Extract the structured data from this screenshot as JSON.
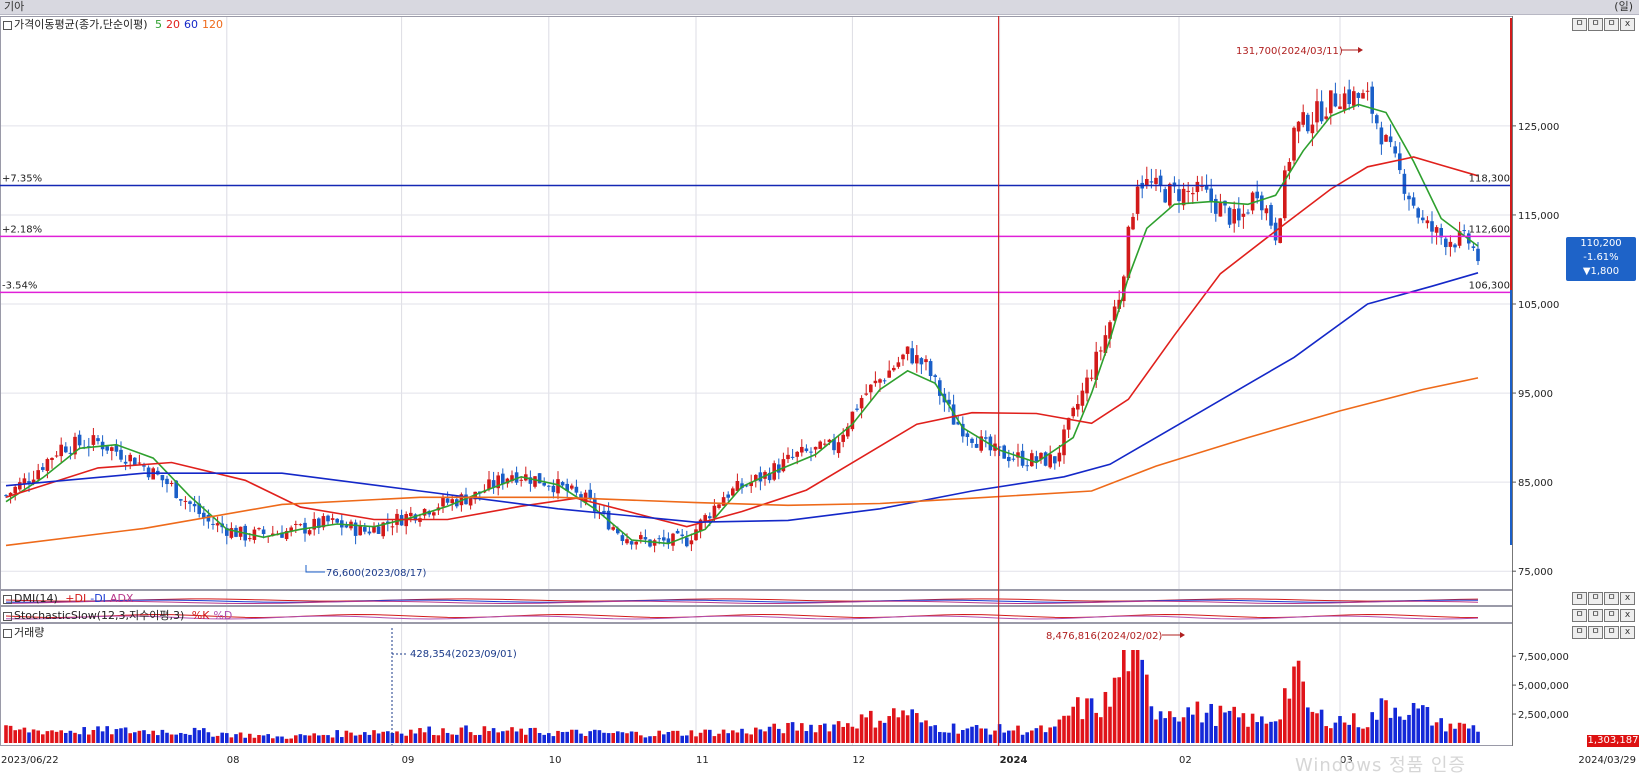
{
  "window": {
    "title": "기아",
    "period_label": "(일)"
  },
  "panels": {
    "price": {
      "legend_name": "가격이동평균(종가,단순이평)",
      "ma": [
        {
          "label": "5",
          "color": "#2ea02e"
        },
        {
          "label": "20",
          "color": "#e0201c"
        },
        {
          "label": "60",
          "color": "#1428c8"
        },
        {
          "label": "120",
          "color": "#ee6a1a"
        }
      ]
    },
    "dmi": {
      "legend_name": "DMI(14)",
      "lines": [
        {
          "label": "+DI",
          "color": "#d21a1a"
        },
        {
          "label": "-DI",
          "color": "#1a3ad2"
        },
        {
          "label": "ADX",
          "color": "#b8398a"
        }
      ]
    },
    "stoch": {
      "legend_name": "StochasticSlow(12,3,지수이평,3)",
      "lines": [
        {
          "label": "%K",
          "color": "#d21a1a"
        },
        {
          "label": "%D",
          "color": "#b050b0"
        }
      ]
    },
    "volume": {
      "legend_name": "거래량"
    }
  },
  "panel_buttons": [
    "ㅁ",
    "ㅁ",
    "ㅁ",
    "x"
  ],
  "hlines": [
    {
      "pct": "+7.35%",
      "value": "118,300",
      "price": 118300,
      "color": "#1428b4"
    },
    {
      "pct": "+2.18%",
      "value": "112,600",
      "price": 112600,
      "color": "#e020d8"
    },
    {
      "pct": "-3.54%",
      "value": "106,300",
      "price": 106300,
      "color": "#e020d8"
    }
  ],
  "current": {
    "price": "110,200",
    "change_pct": "-1.61%",
    "change": "▼1,800"
  },
  "volume_current": "1,303,187",
  "annotations": {
    "price_high": "131,700(2024/03/11)",
    "price_low": "76,600(2023/08/17)",
    "volume_high": "8,476,816(2024/02/02)",
    "volume_low": "428,354(2023/09/01)"
  },
  "watermark": "Windows 정품 인증",
  "chart_data": {
    "type": "candlestick",
    "title": "기아",
    "period": "일",
    "date_range": [
      "2023/06/22",
      "2024/03/29"
    ],
    "x_labels": [
      "2023/06/22",
      "08",
      "09",
      "10",
      "11",
      "12",
      "2024",
      "02",
      "03",
      "2024/03/29"
    ],
    "price_axis": {
      "ticks": [
        "125,000",
        "115,000",
        "105,000",
        "95,000",
        "85,000",
        "75,000"
      ],
      "range": [
        73000,
        137000
      ]
    },
    "volume_axis": {
      "ticks": [
        "7,500,000",
        "5,000,000",
        "2,500,000"
      ],
      "range": [
        0,
        9500000
      ]
    },
    "close_anchors": [
      [
        0,
        83500
      ],
      [
        5,
        85500
      ],
      [
        12,
        89000
      ],
      [
        20,
        89500
      ],
      [
        28,
        87500
      ],
      [
        36,
        84500
      ],
      [
        44,
        80500
      ],
      [
        52,
        79000
      ],
      [
        62,
        79500
      ],
      [
        70,
        80500
      ],
      [
        78,
        79500
      ],
      [
        86,
        81000
      ],
      [
        94,
        82500
      ],
      [
        102,
        83500
      ],
      [
        110,
        86000
      ],
      [
        118,
        85000
      ],
      [
        126,
        83000
      ],
      [
        134,
        79000
      ],
      [
        140,
        78200
      ],
      [
        148,
        78500
      ],
      [
        156,
        83500
      ],
      [
        164,
        85500
      ],
      [
        172,
        88000
      ],
      [
        180,
        89000
      ],
      [
        186,
        94500
      ],
      [
        192,
        97500
      ],
      [
        196,
        99500
      ],
      [
        200,
        98000
      ],
      [
        206,
        92000
      ],
      [
        214,
        88500
      ],
      [
        222,
        87500
      ],
      [
        228,
        87500
      ],
      [
        232,
        92500
      ],
      [
        238,
        100000
      ],
      [
        242,
        106000
      ],
      [
        246,
        119000
      ],
      [
        252,
        117500
      ],
      [
        260,
        117500
      ],
      [
        268,
        114000
      ],
      [
        272,
        118000
      ],
      [
        276,
        113000
      ],
      [
        280,
        124500
      ],
      [
        284,
        126000
      ],
      [
        290,
        128500
      ],
      [
        296,
        128000
      ],
      [
        300,
        123000
      ],
      [
        304,
        118500
      ],
      [
        308,
        114000
      ],
      [
        312,
        112500
      ],
      [
        318,
        112000
      ],
      [
        320,
        110200
      ]
    ],
    "ma_lines": [
      {
        "name": "5",
        "points": [
          [
            0,
            82800
          ],
          [
            8,
            85500
          ],
          [
            16,
            88800
          ],
          [
            24,
            89200
          ],
          [
            32,
            87700
          ],
          [
            40,
            83400
          ],
          [
            48,
            79700
          ],
          [
            56,
            78800
          ],
          [
            64,
            79700
          ],
          [
            72,
            80300
          ],
          [
            80,
            80000
          ],
          [
            88,
            81000
          ],
          [
            96,
            82300
          ],
          [
            104,
            84000
          ],
          [
            112,
            85600
          ],
          [
            120,
            84700
          ],
          [
            128,
            82000
          ],
          [
            136,
            78500
          ],
          [
            144,
            78100
          ],
          [
            152,
            79700
          ],
          [
            160,
            84500
          ],
          [
            168,
            86400
          ],
          [
            176,
            88100
          ],
          [
            184,
            91500
          ],
          [
            190,
            95400
          ],
          [
            196,
            97500
          ],
          [
            202,
            96100
          ],
          [
            208,
            91100
          ],
          [
            216,
            88600
          ],
          [
            224,
            87200
          ],
          [
            232,
            90000
          ],
          [
            236,
            95000
          ],
          [
            240,
            101000
          ],
          [
            244,
            108000
          ],
          [
            248,
            113500
          ],
          [
            254,
            116200
          ],
          [
            262,
            116500
          ],
          [
            270,
            116200
          ],
          [
            276,
            117200
          ],
          [
            282,
            122200
          ],
          [
            288,
            126100
          ],
          [
            294,
            127400
          ],
          [
            300,
            126500
          ],
          [
            306,
            121000
          ],
          [
            312,
            114600
          ],
          [
            320,
            111500
          ]
        ]
      },
      {
        "name": "20",
        "points": [
          [
            0,
            83300
          ],
          [
            20,
            86600
          ],
          [
            36,
            87200
          ],
          [
            52,
            85200
          ],
          [
            64,
            82200
          ],
          [
            80,
            80800
          ],
          [
            96,
            80800
          ],
          [
            112,
            82300
          ],
          [
            124,
            83200
          ],
          [
            136,
            81600
          ],
          [
            148,
            80000
          ],
          [
            160,
            81700
          ],
          [
            174,
            84100
          ],
          [
            186,
            87800
          ],
          [
            198,
            91500
          ],
          [
            210,
            92800
          ],
          [
            224,
            92700
          ],
          [
            236,
            91600
          ],
          [
            244,
            94300
          ],
          [
            254,
            101500
          ],
          [
            264,
            108400
          ],
          [
            276,
            113200
          ],
          [
            288,
            117900
          ],
          [
            296,
            120400
          ],
          [
            306,
            121500
          ],
          [
            312,
            120600
          ],
          [
            320,
            119400
          ]
        ]
      },
      {
        "name": "60",
        "points": [
          [
            0,
            84600
          ],
          [
            30,
            86000
          ],
          [
            60,
            86000
          ],
          [
            90,
            84000
          ],
          [
            120,
            82000
          ],
          [
            150,
            80500
          ],
          [
            170,
            80700
          ],
          [
            190,
            82000
          ],
          [
            210,
            84000
          ],
          [
            230,
            85600
          ],
          [
            240,
            87000
          ],
          [
            260,
            93000
          ],
          [
            280,
            99000
          ],
          [
            296,
            105000
          ],
          [
            310,
            107000
          ],
          [
            320,
            108500
          ]
        ]
      },
      {
        "name": "120",
        "points": [
          [
            0,
            77900
          ],
          [
            30,
            79800
          ],
          [
            60,
            82500
          ],
          [
            90,
            83300
          ],
          [
            120,
            83300
          ],
          [
            150,
            82700
          ],
          [
            170,
            82400
          ],
          [
            190,
            82600
          ],
          [
            210,
            83200
          ],
          [
            236,
            84000
          ],
          [
            250,
            86800
          ],
          [
            270,
            90000
          ],
          [
            290,
            93000
          ],
          [
            308,
            95400
          ],
          [
            320,
            96700
          ]
        ]
      }
    ],
    "volume_anchors": [
      [
        0,
        1.1
      ],
      [
        40,
        1.0
      ],
      [
        60,
        0.5
      ],
      [
        80,
        1.0
      ],
      [
        100,
        1.1
      ],
      [
        120,
        0.9
      ],
      [
        140,
        0.8
      ],
      [
        160,
        1.0
      ],
      [
        180,
        1.6
      ],
      [
        190,
        2.2
      ],
      [
        196,
        2.7
      ],
      [
        200,
        1.5
      ],
      [
        210,
        1.2
      ],
      [
        228,
        1.1
      ],
      [
        232,
        2.9
      ],
      [
        236,
        3.0
      ],
      [
        240,
        3.5
      ],
      [
        244,
        8.5
      ],
      [
        250,
        3.0
      ],
      [
        256,
        2.8
      ],
      [
        262,
        2.5
      ],
      [
        268,
        2.2
      ],
      [
        272,
        1.8
      ],
      [
        276,
        2.2
      ],
      [
        280,
        6.0
      ],
      [
        284,
        2.4
      ],
      [
        290,
        2.0
      ],
      [
        296,
        1.8
      ],
      [
        300,
        3.3
      ],
      [
        304,
        3.0
      ],
      [
        308,
        2.6
      ],
      [
        312,
        1.6
      ],
      [
        320,
        1.3
      ]
    ]
  }
}
